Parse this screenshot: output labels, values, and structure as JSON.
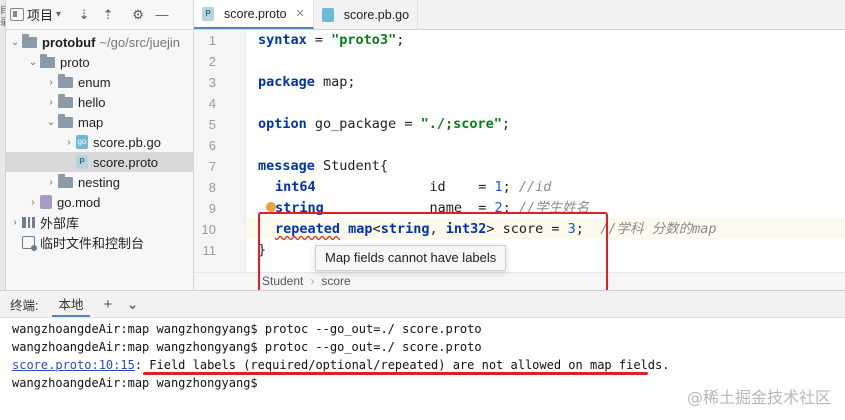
{
  "edge_strip": {
    "label": "目录"
  },
  "project_panel": {
    "toolbar": {
      "project_label": "项目",
      "dropdown": "▾"
    },
    "tree": [
      {
        "label": "protobuf",
        "hint": "~/go/src/juejin",
        "bold": true,
        "chev": "⌄",
        "indent": 0,
        "icon": "folder"
      },
      {
        "label": "proto",
        "chev": "⌄",
        "indent": 1,
        "icon": "folder"
      },
      {
        "label": "enum",
        "chev": "›",
        "indent": 2,
        "icon": "folder"
      },
      {
        "label": "hello",
        "chev": "›",
        "indent": 2,
        "icon": "folder"
      },
      {
        "label": "map",
        "chev": "⌄",
        "indent": 2,
        "icon": "folder"
      },
      {
        "label": "score.pb.go",
        "chev": "›",
        "indent": 3,
        "icon": "go"
      },
      {
        "label": "score.proto",
        "chev": "",
        "indent": 3,
        "icon": "proto",
        "selected": true
      },
      {
        "label": "nesting",
        "chev": "›",
        "indent": 2,
        "icon": "folder"
      },
      {
        "label": "go.mod",
        "chev": "›",
        "indent": 1,
        "icon": "gomod"
      },
      {
        "label": "外部库",
        "chev": "›",
        "indent": 0,
        "icon": "lib"
      },
      {
        "label": "临时文件和控制台",
        "chev": "",
        "indent": 0,
        "icon": "scratch"
      }
    ]
  },
  "editor": {
    "tabs": [
      {
        "label": "score.proto",
        "icon": "P",
        "active": true
      },
      {
        "label": "score.pb.go",
        "icon": "go",
        "active": false
      }
    ],
    "line_numbers": [
      "1",
      "2",
      "3",
      "4",
      "5",
      "6",
      "7",
      "8",
      "9",
      "10",
      "11"
    ],
    "code": {
      "l1_kw": "syntax",
      "l1_eq": " = ",
      "l1_str": "\"proto3\"",
      "l1_end": ";",
      "l3_kw": "package",
      "l3_rest": " map;",
      "l5_kw": "option",
      "l5_mid": " go_package = ",
      "l5_str": "\"./;score\"",
      "l5_end": ";",
      "l7_kw": "message",
      "l7_rest": " Student{",
      "l8_kw": "int64",
      "l8_mid": "              id    = ",
      "l8_num": "1",
      "l8_semi": "; ",
      "l8_cm": "//id",
      "l9_kw": "string",
      "l9_mid": "             name  = ",
      "l9_num": "2",
      "l9_semi": "; ",
      "l9_cm": "//学生姓名",
      "l10_kw": "repeated",
      "l10_kw2": " map",
      "l10_mid1": "<",
      "l10_kw3": "string",
      "l10_mid2": ", ",
      "l10_kw4": "int32",
      "l10_mid3": "> score = ",
      "l10_num": "3",
      "l10_semi": ";  ",
      "l10_cm": "//学科 分数的map",
      "l11": "}"
    },
    "tooltip": "Map fields cannot have labels",
    "breadcrumb": [
      "Student",
      "score"
    ]
  },
  "terminal": {
    "header": {
      "title": "终端:",
      "tab": "本地",
      "add": "+",
      "menu": "⌄"
    },
    "lines": [
      "wangzhoangdeAir:map wangzhongyang$ protoc --go_out=./ score.proto",
      "wangzhoangdeAir:map wangzhongyang$ protoc --go_out=./ score.proto"
    ],
    "error_link": "score.proto:10:15",
    "error_msg": ": Field labels (required/optional/repeated) are not allowed on map fields.",
    "prompt": "wangzhoangdeAir:map wangzhongyang$"
  },
  "watermark": "@稀土掘金技术社区"
}
